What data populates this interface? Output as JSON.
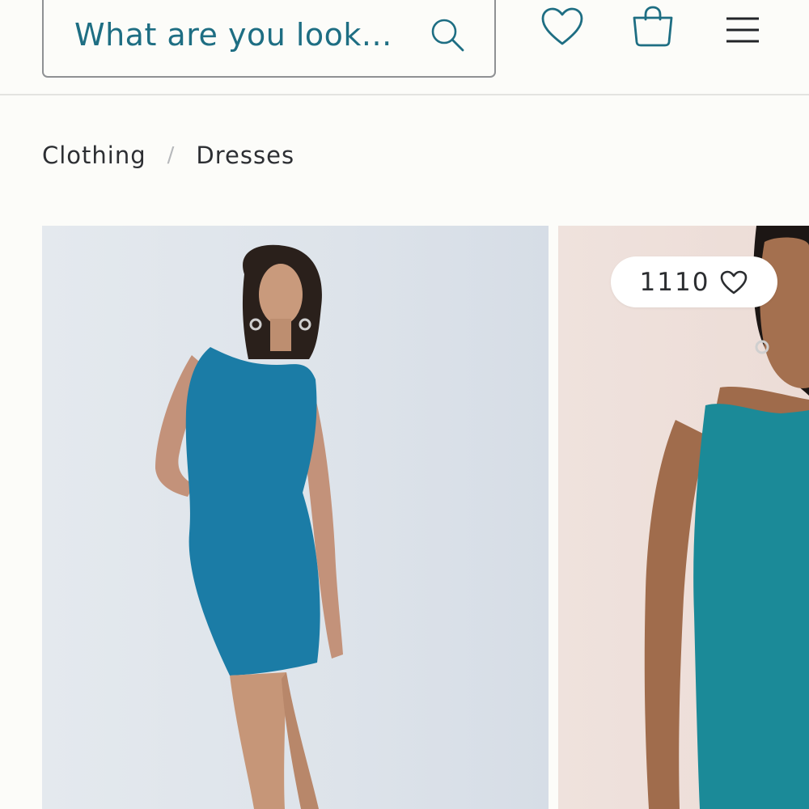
{
  "header": {
    "search": {
      "placeholder": "What are you look..."
    },
    "icons": [
      "search-icon",
      "heart-icon",
      "shopping-bag-icon",
      "hamburger-menu-icon"
    ]
  },
  "breadcrumb": {
    "items": [
      "Clothing",
      "Dresses"
    ],
    "separator": "/"
  },
  "products": [
    {
      "image": "model-in-blue-textured-sleeveless-mini-dress"
    },
    {
      "image": "model-in-teal-textured-sleeveless-dress",
      "likes": "1110"
    }
  ],
  "colors": {
    "accent": "#1e6e83",
    "text": "#2d2f33",
    "separator": "#b6b8bb",
    "background": "#fcfcf9",
    "dress_blue": "#1b7ca6",
    "dress_teal": "#1b8a98"
  }
}
